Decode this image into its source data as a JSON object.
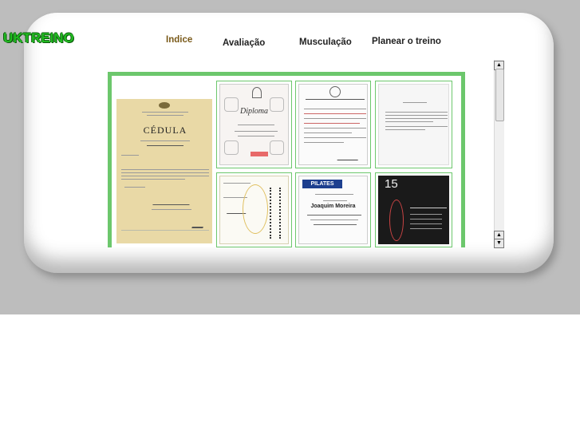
{
  "brand": {
    "logo_text": "UKTREINO"
  },
  "nav": {
    "items": [
      {
        "label": "Indice",
        "active": true
      },
      {
        "label": "Avaliação",
        "active": false
      },
      {
        "label": "Musculação",
        "active": false
      },
      {
        "label": "Planear o treino",
        "active": false
      }
    ]
  },
  "gallery": {
    "cedula_heading": "CÉDULA",
    "diploma_heading": "Diploma",
    "pilates_heading": "PILATES",
    "pilates_name": "Joaquim Moreira",
    "poster_number": "15"
  },
  "colors": {
    "accent_green": "#6cc76c",
    "logo_green": "#22bb22",
    "active_nav": "#7a5a1a"
  },
  "scrollbar": {
    "up_icon": "arrow-up-icon",
    "down_icon": "arrow-down-icon"
  }
}
